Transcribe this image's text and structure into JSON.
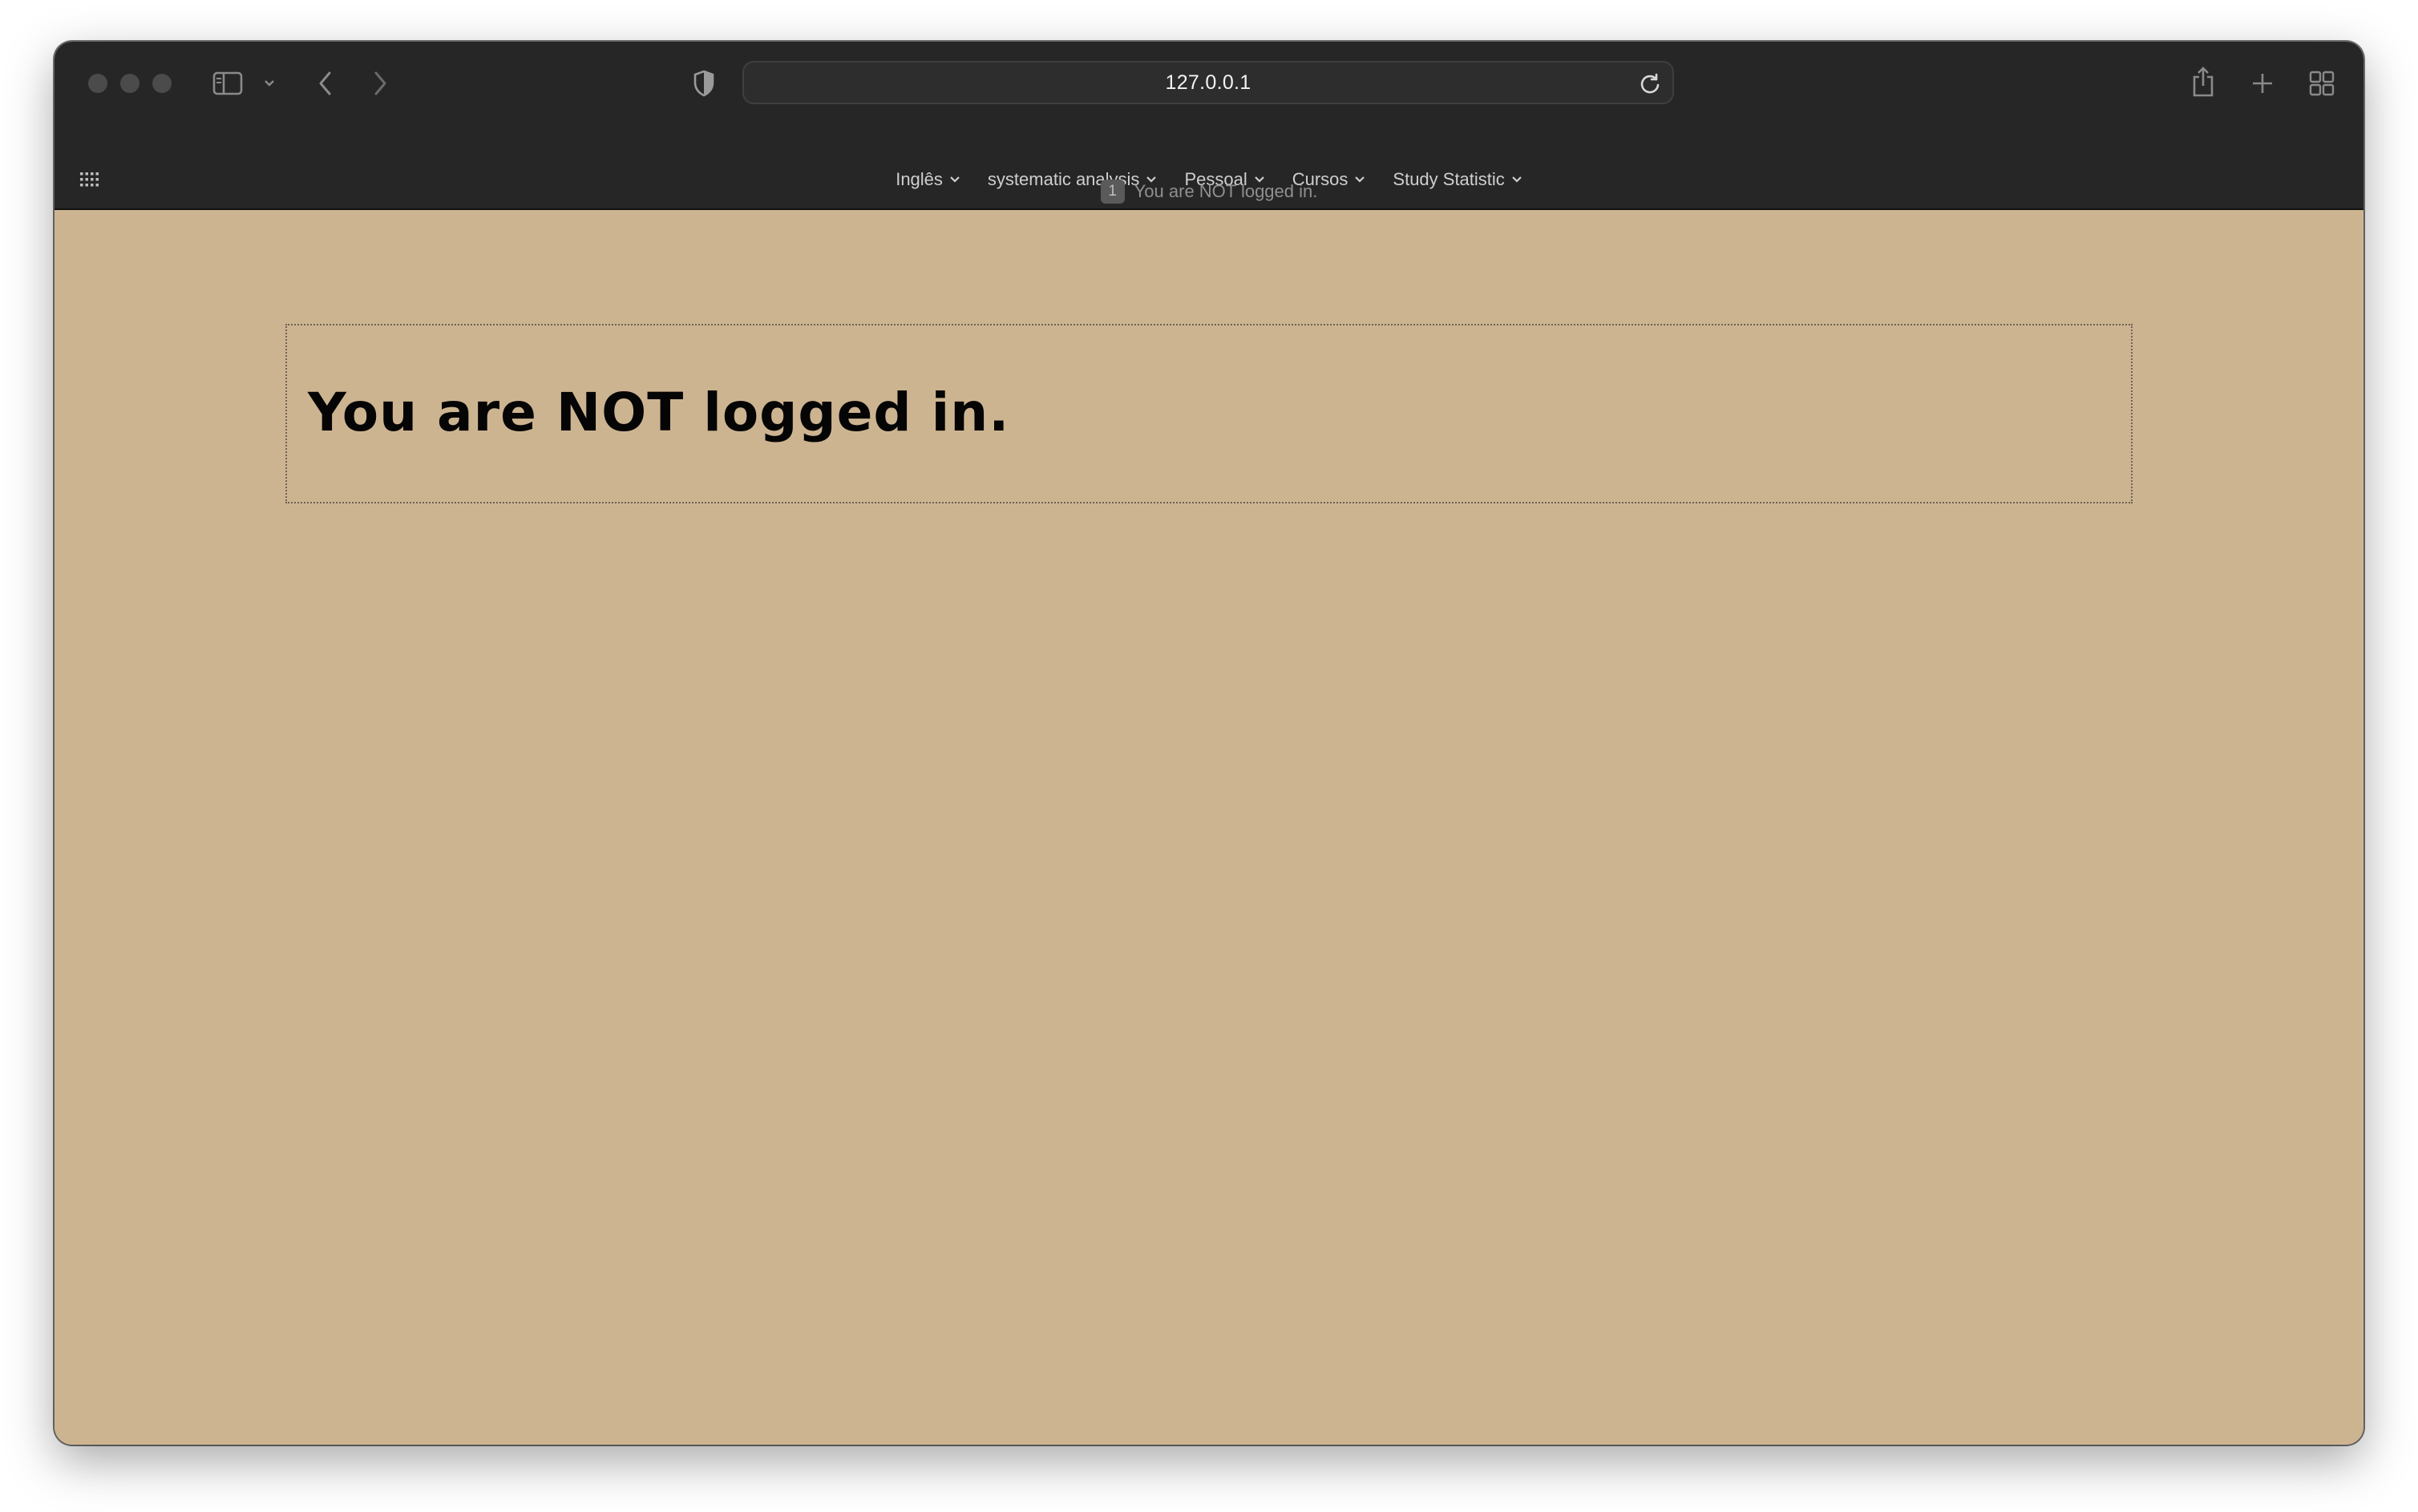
{
  "browser": {
    "address": "127.0.0.1",
    "favorites": [
      {
        "label": "Inglês"
      },
      {
        "label": "systematic analysis"
      },
      {
        "label": "Pessoal"
      },
      {
        "label": "Cursos"
      },
      {
        "label": "Study Statistic"
      }
    ],
    "tab": {
      "badge": "1",
      "title": "You are NOT logged in."
    },
    "icons": {
      "sidebar": "sidebar-icon",
      "back": "chevron-left-icon",
      "forward": "chevron-right-icon",
      "privacy": "shield-icon",
      "reload": "reload-icon",
      "share": "share-icon",
      "new_tab": "plus-icon",
      "tab_overview": "grid-icon",
      "apps": "apps-grid-icon"
    },
    "colors": {
      "toolbar": "#262626",
      "page_background": "#cdb491"
    }
  },
  "page": {
    "message": "You are NOT logged in."
  }
}
